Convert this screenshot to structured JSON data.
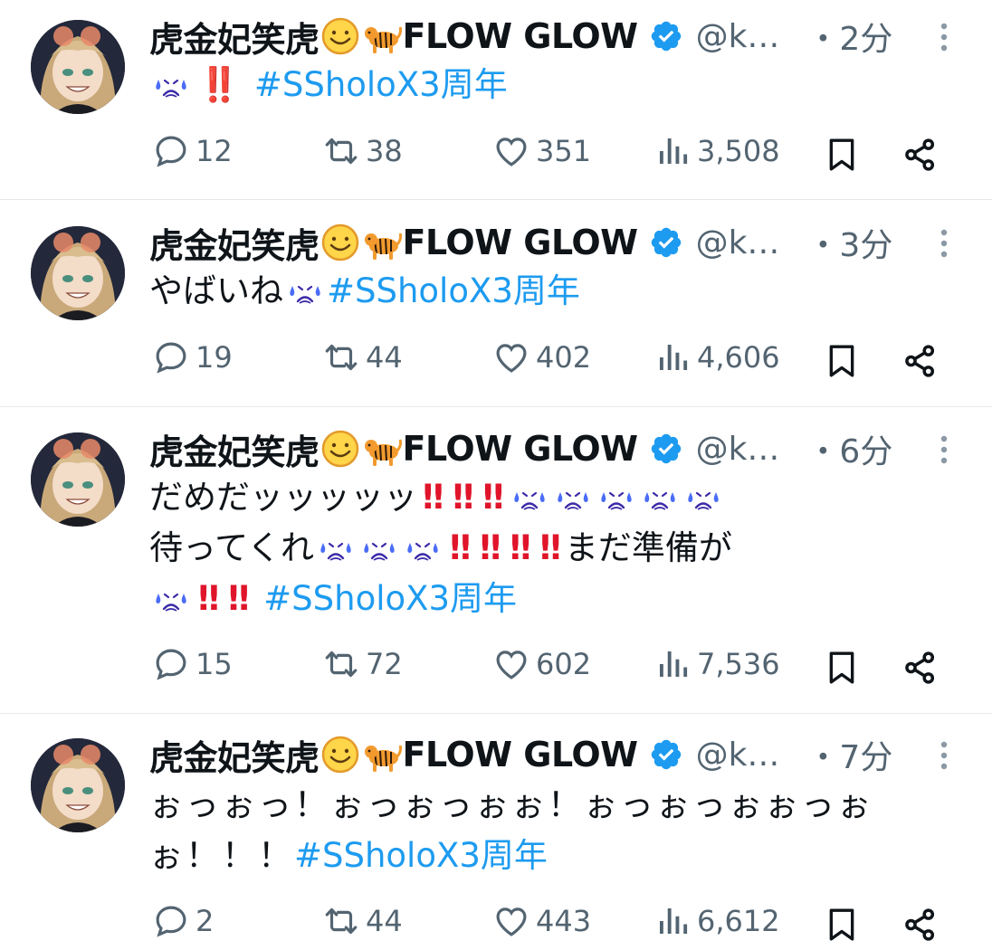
{
  "author": {
    "name_prefix": "虎金妃笑虎",
    "name_suffix": "FLOW GLOW",
    "handle": "@k…"
  },
  "colors": {
    "hashtag": "#1d9bf0",
    "verified": "#1d9bf0",
    "muted": "#536471",
    "exclaim": "#e0142a"
  },
  "icons": [
    "smile-emoji-icon",
    "tiger-emoji-icon",
    "verified-badge-icon",
    "more-icon",
    "sweat-emoji-icon",
    "double-exclamation-icon",
    "reply-icon",
    "retweet-icon",
    "like-icon",
    "views-icon",
    "bookmark-icon",
    "share-icon"
  ],
  "tweets": [
    {
      "time": "・2分",
      "lines": [
        "‼️"
      ],
      "hashtag": "#SSholoX3周年",
      "stats": {
        "replies": "12",
        "retweets": "38",
        "likes": "351",
        "views": "3,508"
      }
    },
    {
      "time": "・3分",
      "lines": [
        "やばいね"
      ],
      "hashtag": "#SSholoX3周年",
      "stats": {
        "replies": "19",
        "retweets": "44",
        "likes": "402",
        "views": "4,606"
      }
    },
    {
      "time": "・6分",
      "lines": [
        "だめだッッッッッ",
        "待ってくれ",
        "まだ準備が"
      ],
      "hashtag": "#SSholoX3周年",
      "stats": {
        "replies": "15",
        "retweets": "72",
        "likes": "602",
        "views": "7,536"
      }
    },
    {
      "time": "・7分",
      "lines": [
        "ぉっぉっ！ぉっぉっぉぉ！ぉっぉっぉぉっぉ",
        "ぉ！！！"
      ],
      "hashtag": "#SSholoX3周年",
      "stats": {
        "replies": "2",
        "retweets": "44",
        "likes": "443",
        "views": "6,612"
      }
    }
  ]
}
